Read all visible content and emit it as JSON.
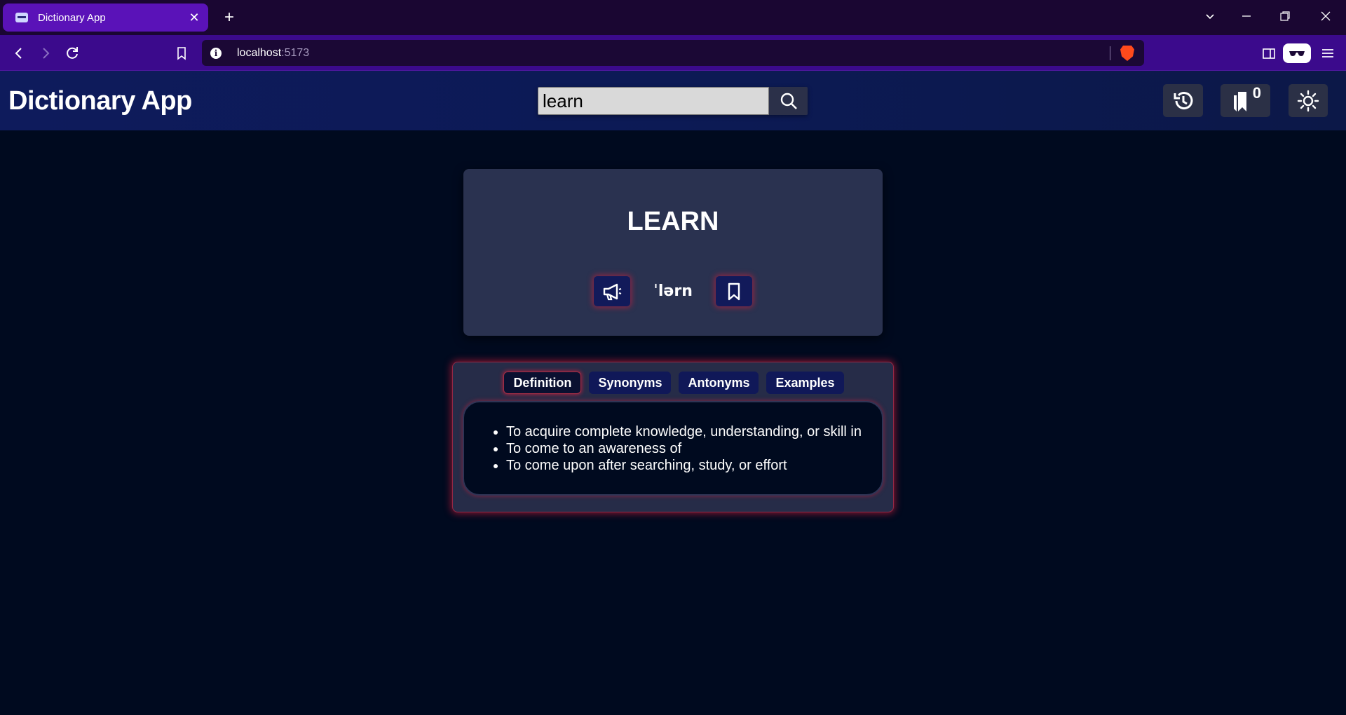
{
  "browser": {
    "tab_title": "Dictionary App",
    "url_host": "localhost",
    "url_port": ":5173"
  },
  "header": {
    "app_title": "Dictionary App",
    "search_value": "learn",
    "bookmark_count": "0"
  },
  "word": {
    "title": "LEARN",
    "phonetic": "ˈlərn"
  },
  "tabs": [
    {
      "label": "Definition",
      "active": true
    },
    {
      "label": "Synonyms",
      "active": false
    },
    {
      "label": "Antonyms",
      "active": false
    },
    {
      "label": "Examples",
      "active": false
    }
  ],
  "definitions": [
    "To acquire complete knowledge, understanding, or skill in",
    "To come to an awareness of",
    "To come upon after searching, study, or effort"
  ],
  "colors": {
    "page_bg": "#000a1f",
    "header_bg": "#0e1b5c",
    "card_bg": "#2a3250",
    "tab_bg": "#101858",
    "glow": "#dc1e3c",
    "browser_tab": "#5a12b8",
    "browser_toolbar": "#3b0a8c"
  },
  "icons": {
    "pronounce": "megaphone-icon",
    "bookmark": "bookmark-icon",
    "history": "history-icon",
    "bookmarks": "bookmarks-icon",
    "theme": "sun-icon",
    "search": "search-icon"
  }
}
